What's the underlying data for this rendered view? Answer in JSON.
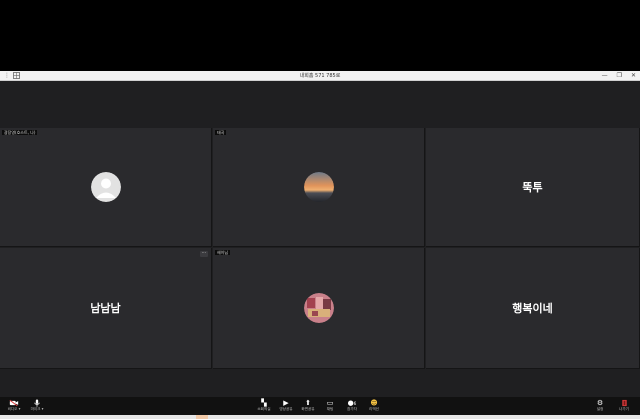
{
  "window": {
    "title": "내회홈 571 785로"
  },
  "tiles": [
    {
      "tag": "광장영(호스트, 나)",
      "big_name": ""
    },
    {
      "tag": "태곡",
      "big_name": ""
    },
    {
      "tag": "",
      "big_name": "뚝투"
    },
    {
      "tag": "",
      "big_name": "남남남"
    },
    {
      "tag": "헤이님",
      "big_name": ""
    },
    {
      "tag": "",
      "big_name": "행복이네"
    }
  ],
  "toolbar": {
    "left": [
      {
        "label": "비디오 ▾",
        "icon": "video-off-icon"
      },
      {
        "label": "마이크 ▾",
        "icon": "microphone-icon"
      }
    ],
    "center": [
      {
        "label": "소회의실",
        "icon": "breakout-rooms-icon"
      },
      {
        "label": "영상공유",
        "icon": "video-share-icon"
      },
      {
        "label": "화면공유",
        "icon": "screen-share-icon"
      },
      {
        "label": "채팅",
        "icon": "chat-icon"
      },
      {
        "label": "참가자",
        "icon": "participants-icon"
      },
      {
        "label": "리액션",
        "icon": "reaction-icon"
      }
    ],
    "right": [
      {
        "label": "설정",
        "icon": "gear-icon"
      },
      {
        "label": "나가기",
        "icon": "exit-icon"
      }
    ],
    "participant_count": "6"
  },
  "colors": {
    "tile_bg": "#2a2a2d",
    "meeting_bg": "#1f1f21",
    "toolbar_bg": "#111111",
    "exit": "#d83b3b"
  }
}
